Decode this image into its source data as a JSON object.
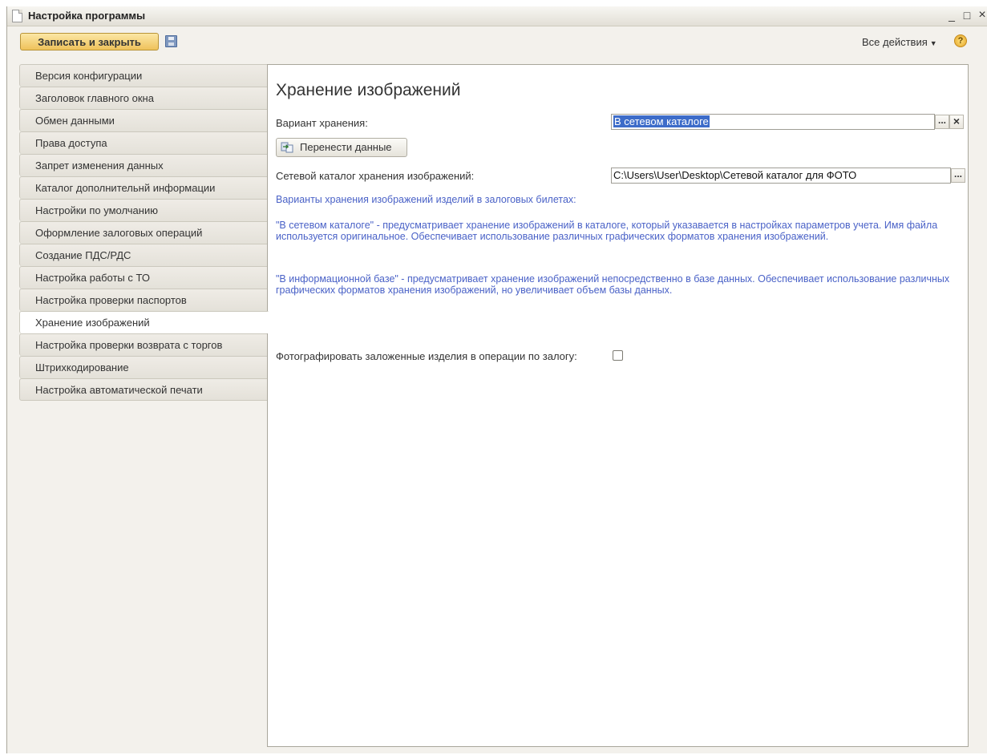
{
  "window": {
    "title": "Настройка программы",
    "minimize_glyph": "_",
    "maximize_glyph": "□",
    "close_glyph": "×"
  },
  "toolbar": {
    "save_close_label": "Записать и закрыть",
    "all_actions_label": "Все действия",
    "help_glyph": "?"
  },
  "tabs": [
    {
      "label": "Версия конфигурации"
    },
    {
      "label": "Заголовок главного окна"
    },
    {
      "label": "Обмен данными"
    },
    {
      "label": "Права доступа"
    },
    {
      "label": "Запрет изменения данных"
    },
    {
      "label": "Каталог дополнительнй информации"
    },
    {
      "label": "Настройки по умолчанию"
    },
    {
      "label": "Оформление залоговых операций"
    },
    {
      "label": "Создание ПДС/РДС"
    },
    {
      "label": "Настройка работы с ТО"
    },
    {
      "label": "Настройка проверки паспортов"
    },
    {
      "label": "Хранение изображений"
    },
    {
      "label": "Настройка проверки возврата с торгов"
    },
    {
      "label": "Штрихкодирование"
    },
    {
      "label": "Настройка автоматической печати"
    }
  ],
  "active_tab": "Хранение изображений",
  "main": {
    "title": "Хранение изображений",
    "storage_variant_label": "Вариант хранения:",
    "storage_variant_value": "В сетевом каталоге",
    "choose_glyph": "...",
    "clear_glyph": "×",
    "transfer_button_label": "Перенести данные",
    "network_catalog_label": "Сетевой каталог хранения изображений:",
    "network_catalog_value": "C:\\Users\\User\\Desktop\\Сетевой каталог для ФОТО",
    "info_heading": "Варианты хранения изображений изделий в залоговых билетах:",
    "info_network": "\"В сетевом каталоге\" - предусматривает хранение изображений в каталоге, который указавается в настройках параметров учета. Имя файла используется оригинальное. Обеспечивает использование различных графических форматов хранения изображений.",
    "info_database": "\"В информационной базе\" - предусматривает хранение изображений непосредственно в базе данных. Обеспечивает использование различных графических форматов хранения изображений, но увеличивает объем базы данных.",
    "photo_checkbox_label": "Фотографировать заложенные изделия в операции по залогу:",
    "photo_checkbox_checked": false
  }
}
